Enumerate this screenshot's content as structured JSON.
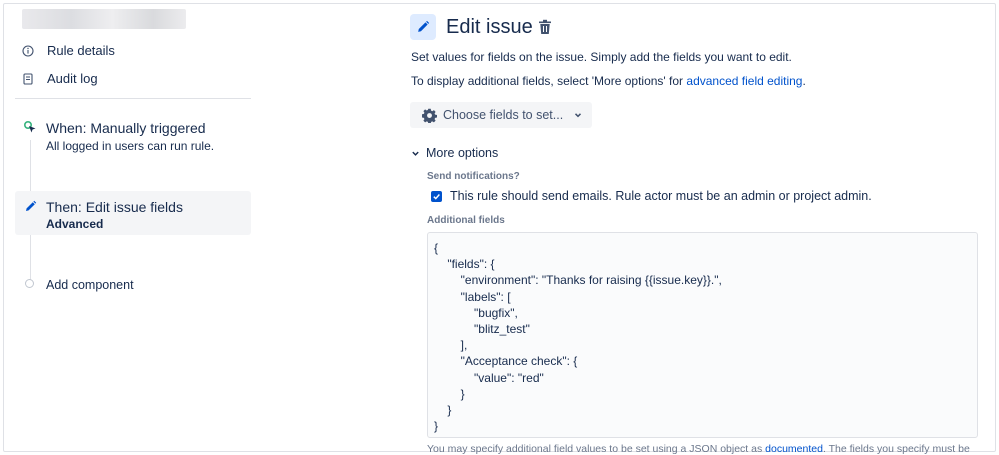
{
  "sidebar": {
    "links": [
      {
        "label": "Rule details",
        "icon": "info-icon"
      },
      {
        "label": "Audit log",
        "icon": "document-icon"
      }
    ],
    "steps": [
      {
        "title": "When: Manually triggered",
        "subtitle": "All logged in users can run rule.",
        "icon": "cursor-trigger-icon",
        "icon_color": "#36b37e"
      },
      {
        "title": "Then: Edit issue fields",
        "subtitle": "Advanced",
        "icon": "pencil-icon",
        "icon_color": "#0052cc"
      }
    ],
    "add_component": "Add component"
  },
  "main": {
    "title": "Edit issue",
    "description": "Set values for fields on the issue. Simply add the fields you want to edit.",
    "display_prefix": "To display additional fields, select 'More options' for ",
    "display_link": "advanced field editing",
    "display_suffix": ".",
    "choose_button": "Choose fields to set...",
    "more_options": "More options",
    "send_notifications_label": "Send notifications?",
    "send_notifications_checked": true,
    "send_notifications_text": "This rule should send emails. Rule actor must be an admin or project admin.",
    "additional_fields_label": "Additional fields",
    "additional_fields_json": "{\n    \"fields\": {\n        \"environment\": \"Thanks for raising {{issue.key}}.\",\n        \"labels\": [\n            \"bugfix\",\n            \"blitz_test\"\n        ],\n        \"Acceptance check\": {\n            \"value\": \"red\"\n        }\n    }\n}",
    "footnote_prefix": "You may specify additional field values to be set using a JSON object as ",
    "footnote_link": "documented",
    "footnote_suffix": ". The fields you specify must be"
  },
  "colors": {
    "accent": "#0052cc",
    "trigger_green": "#36b37e",
    "text": "#172b4d"
  }
}
